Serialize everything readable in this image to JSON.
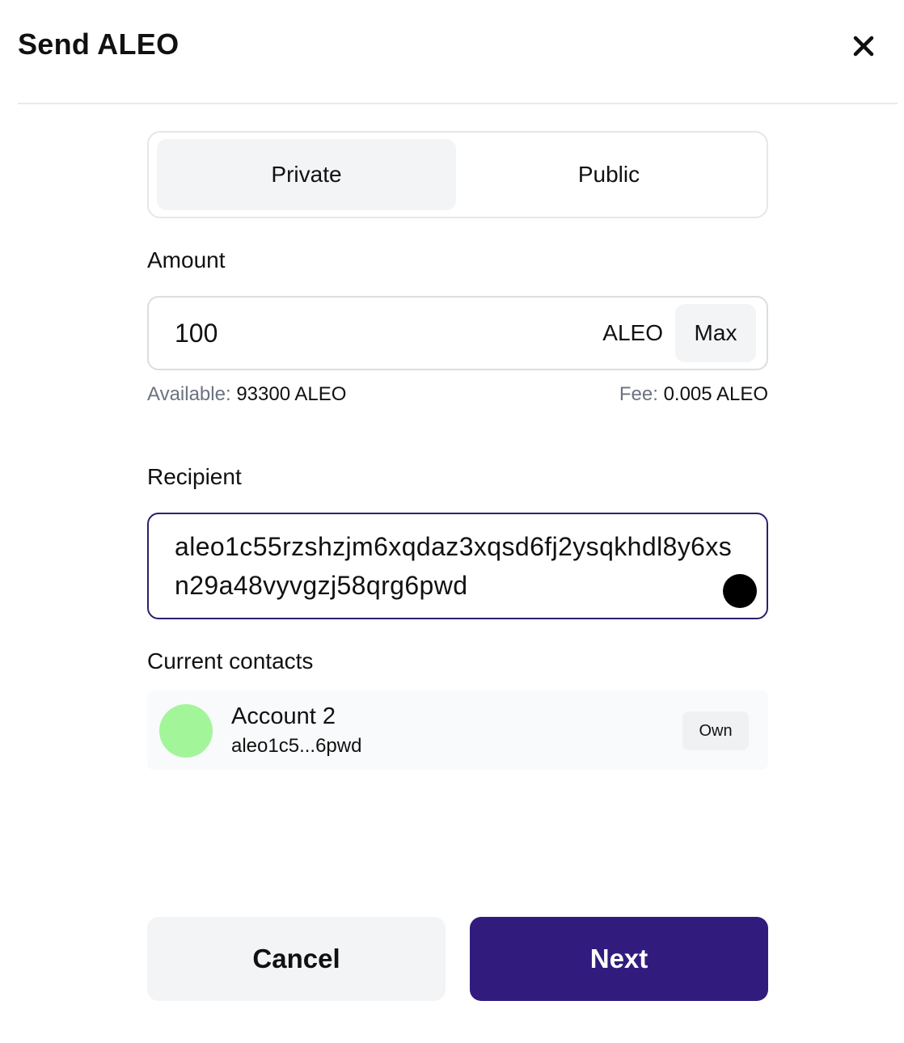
{
  "header": {
    "title": "Send ALEO",
    "close_icon": "close-x-icon"
  },
  "visibility_toggle": {
    "options": [
      "Private",
      "Public"
    ],
    "selected": "Private"
  },
  "amount": {
    "label": "Amount",
    "value": "100",
    "unit": "ALEO",
    "max_label": "Max",
    "available_key": "Available:",
    "available_value": "93300 ALEO",
    "fee_key": "Fee:",
    "fee_value": "0.005 ALEO"
  },
  "recipient": {
    "label": "Recipient",
    "value": "aleo1c55rzshzjm6xqdaz3xqsd6fj2ysqkhdl8y6xsn29a48vyvgzj58qrg6pwd"
  },
  "contacts": {
    "label": "Current contacts",
    "items": [
      {
        "name": "Account 2",
        "address": "aleo1c5...6pwd",
        "badge": "Own",
        "avatar_color": "#a3f59a"
      }
    ]
  },
  "footer": {
    "cancel_label": "Cancel",
    "next_label": "Next"
  },
  "colors": {
    "primary": "#311c7e",
    "focus_border": "#2e1f6e",
    "muted_text": "#6b7280",
    "surface": "#f3f4f6"
  }
}
